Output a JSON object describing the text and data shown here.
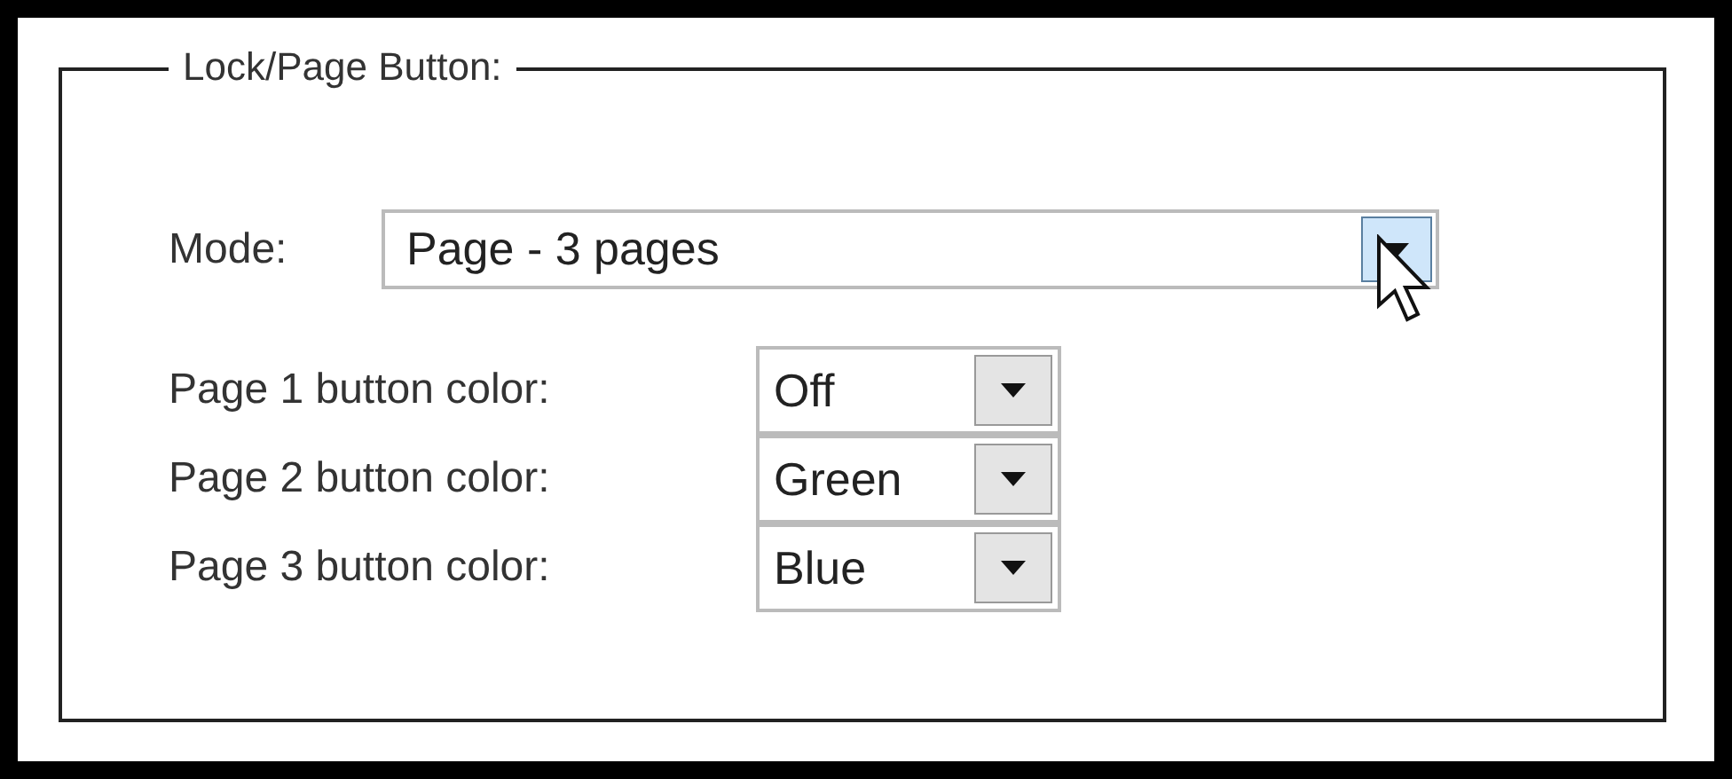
{
  "group": {
    "title": "Lock/Page Button:"
  },
  "mode": {
    "label": "Mode:",
    "value": "Page - 3 pages",
    "hovered": true
  },
  "page_colors": [
    {
      "label": "Page 1 button color:",
      "value": "Off"
    },
    {
      "label": "Page 2 button color:",
      "value": "Green"
    },
    {
      "label": "Page 3 button color:",
      "value": "Blue"
    }
  ]
}
